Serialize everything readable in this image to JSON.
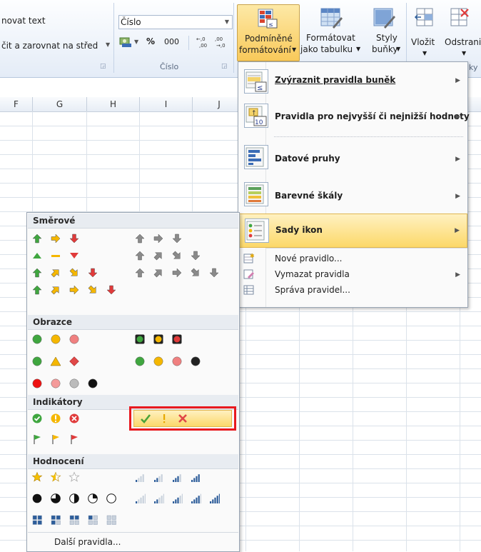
{
  "ribbon": {
    "alignment_partial_1": "novat text",
    "alignment_partial_2": "čit a zarovnat na střed",
    "number_format_value": "Číslo",
    "number_group_label": "Číslo",
    "percent_label": "%",
    "thousands_label": "000",
    "cond_format_label_1": "Podmíněné",
    "cond_format_label_2": "formátování",
    "format_table_label_1": "Formátovat",
    "format_table_label_2": "jako tabulku",
    "cell_styles_label_1": "Styly",
    "cell_styles_label_2": "buňky",
    "insert_label": "Vložit",
    "delete_label": "Odstrani",
    "cells_group_partial": "ky"
  },
  "sheet": {
    "columns": [
      "F",
      "G",
      "H",
      "I",
      "J"
    ]
  },
  "cond_menu": {
    "items": [
      {
        "label": "Zvýraznit pravidla buněk"
      },
      {
        "label": "Pravidla pro nejvyšší či nejnižší hodnoty"
      },
      {
        "label": "Datové pruhy"
      },
      {
        "label": "Barevné škály"
      },
      {
        "label": "Sady ikon"
      }
    ],
    "small_items": [
      {
        "label": "Nové pravidlo..."
      },
      {
        "label": "Vymazat pravidla"
      },
      {
        "label": "Správa pravidel..."
      }
    ]
  },
  "icon_menu": {
    "sections": [
      "Směrové",
      "Obrazce",
      "Indikátory",
      "Hodnocení"
    ],
    "more_rules": "Další pravidla...",
    "highlight_color": "#e8191f",
    "selected_color": "#fbd86a"
  },
  "colors": {
    "green": "#3fa63f",
    "yellow": "#f5b700",
    "red": "#e03a3a",
    "gray": "#8a8a8a",
    "menu_hover": "#fce79f",
    "bar_blue": "#2d5d9a"
  }
}
